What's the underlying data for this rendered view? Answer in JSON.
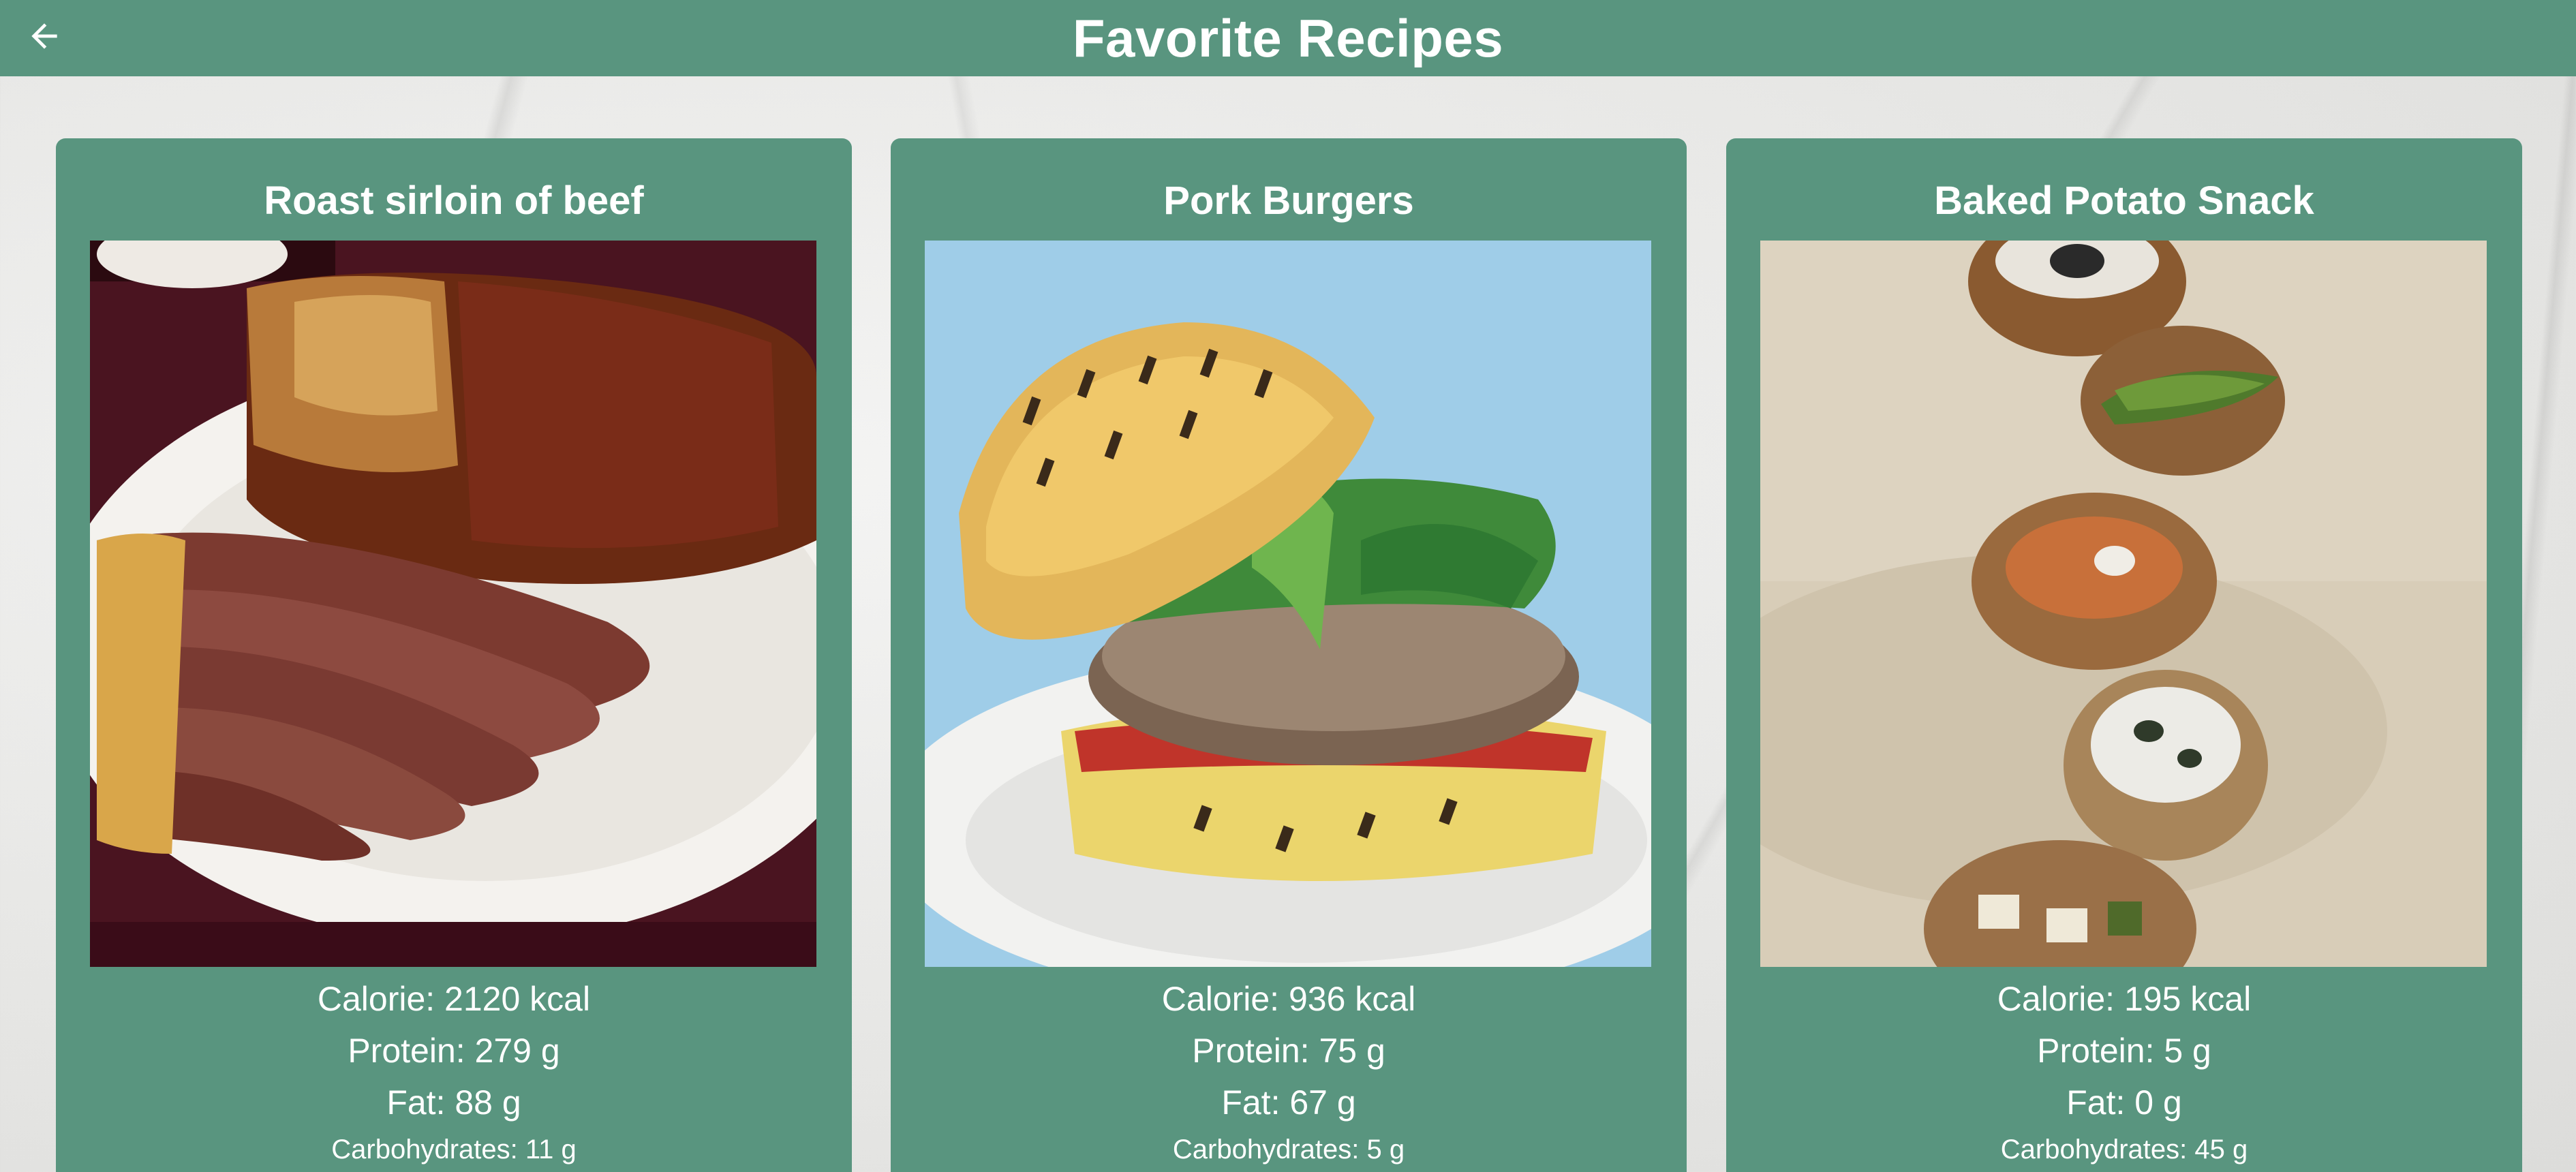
{
  "header": {
    "title": "Favorite Recipes",
    "back_icon": "arrow-left-icon",
    "background_color": "#59957f"
  },
  "recipes": [
    {
      "name": "Roast sirloin of beef",
      "image": "roast-beef-photo",
      "calorie": "Calorie: 2120 kcal",
      "protein": "Protein: 279 g",
      "fat": "Fat: 88 g",
      "carbohydrates": "Carbohydrates: 11 g"
    },
    {
      "name": "Pork Burgers",
      "image": "pork-burger-photo",
      "calorie": "Calorie: 936 kcal",
      "protein": "Protein: 75 g",
      "fat": "Fat: 67 g",
      "carbohydrates": "Carbohydrates: 5 g"
    },
    {
      "name": "Baked Potato Snack",
      "image": "baked-potato-photo",
      "calorie": "Calorie: 195 kcal",
      "protein": "Protein: 5 g",
      "fat": "Fat: 0 g",
      "carbohydrates": "Carbohydrates: 45 g"
    }
  ]
}
